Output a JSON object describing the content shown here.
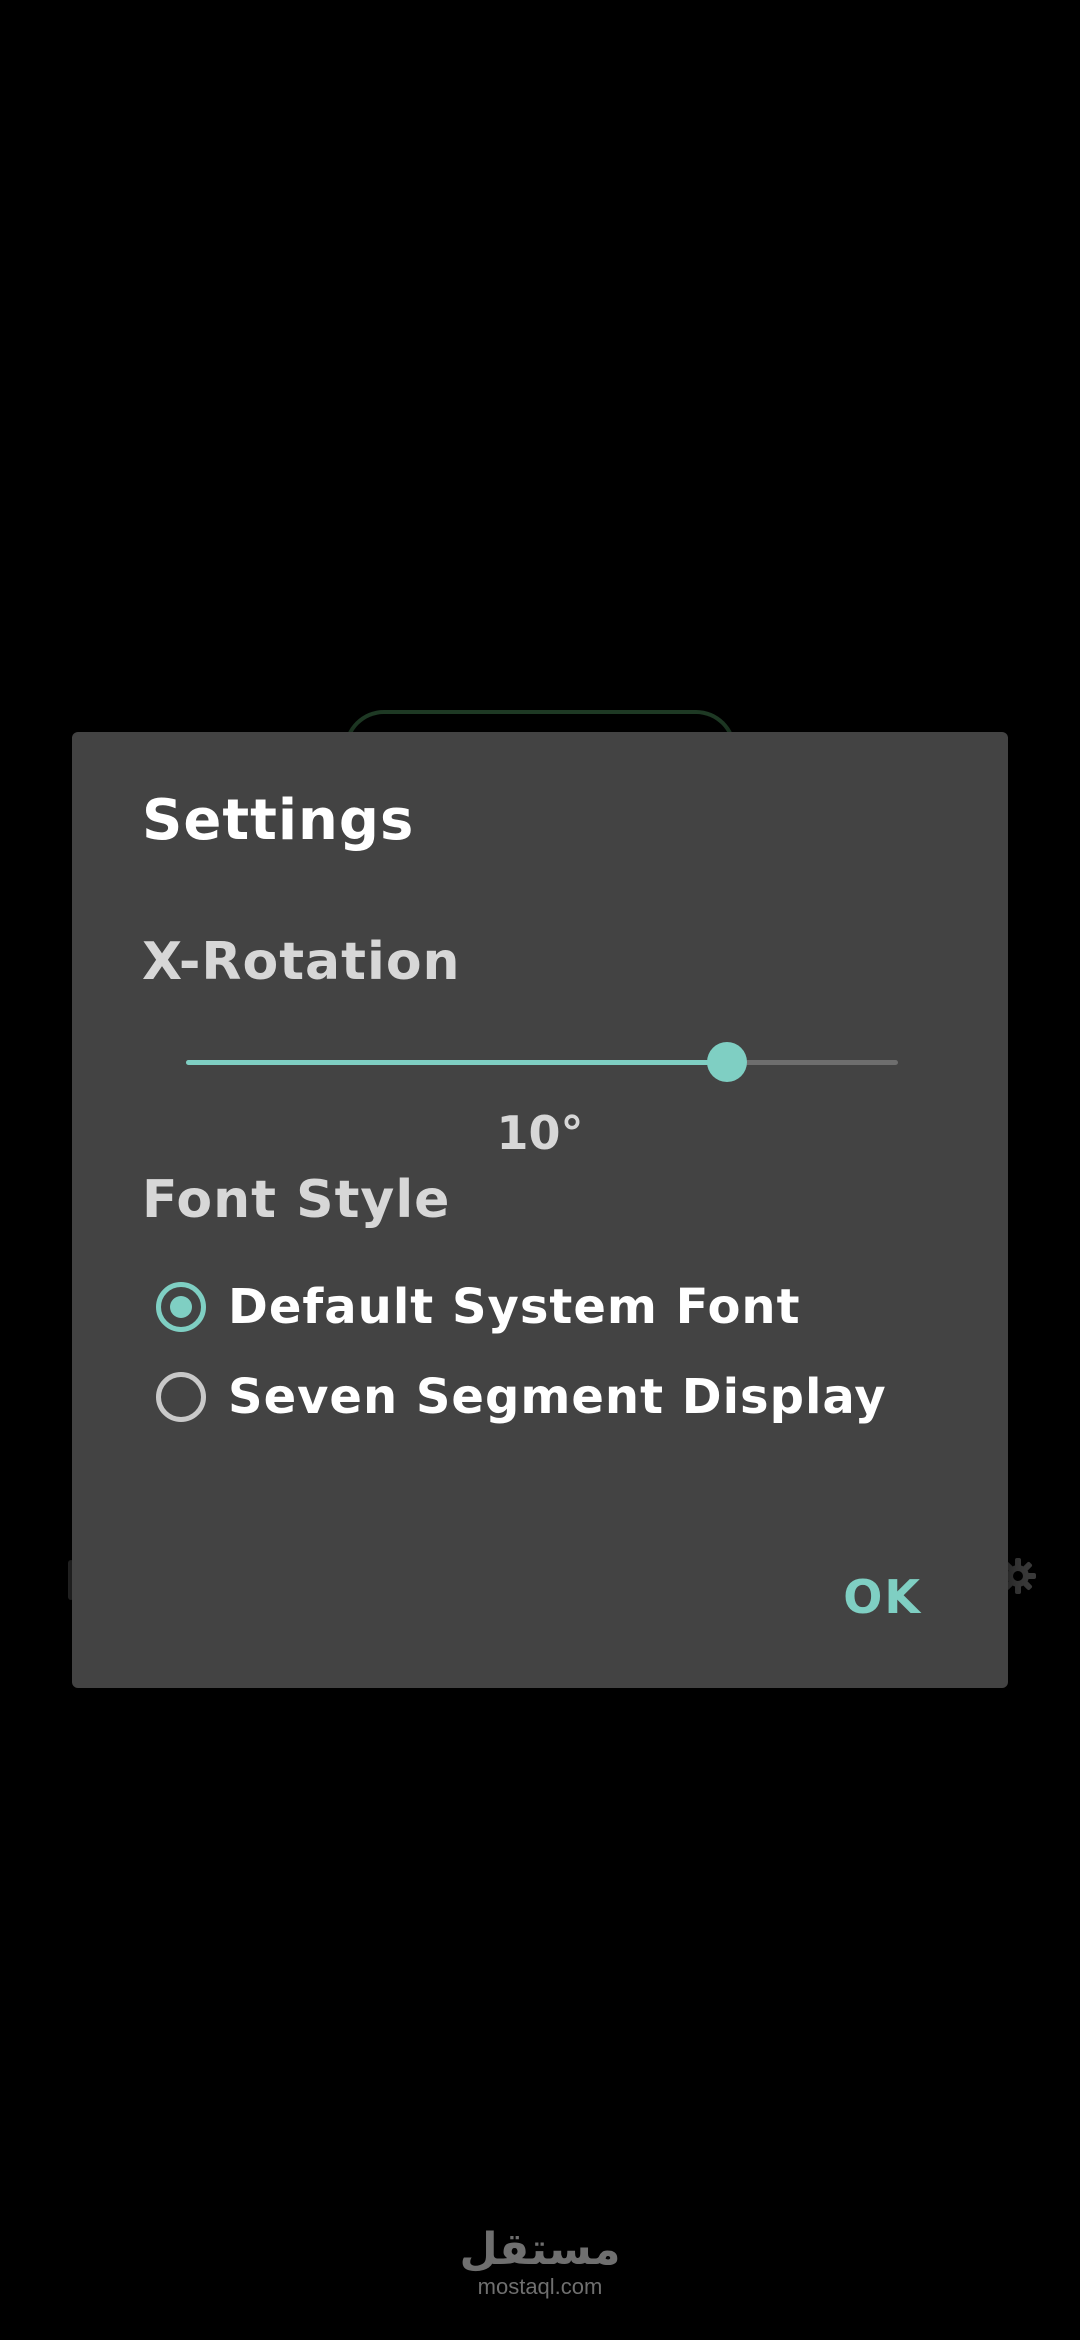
{
  "dialog": {
    "title": "Settings",
    "rotation": {
      "label": "X-Rotation",
      "value_text": "10°",
      "slider_fraction": 0.76
    },
    "font_style": {
      "label": "Font Style",
      "options": [
        {
          "label": "Default System Font",
          "selected": true
        },
        {
          "label": "Seven Segment Display",
          "selected": false
        }
      ]
    },
    "ok_label": "OK"
  },
  "watermark": {
    "arabic": "مستقل",
    "latin": "mostaql.com"
  },
  "colors": {
    "accent": "#7fcfc3",
    "dialog_bg": "#434343",
    "screen_bg": "#000000"
  }
}
